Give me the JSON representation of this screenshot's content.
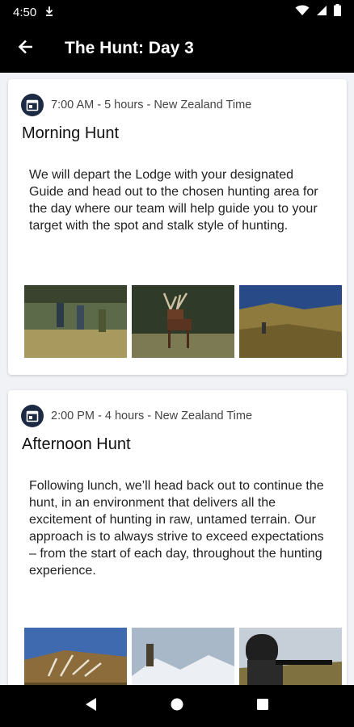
{
  "status_bar": {
    "time": "4:50",
    "icons": [
      "download-icon",
      "wifi-icon",
      "signal-icon",
      "battery-icon"
    ]
  },
  "app_bar": {
    "back_icon": "arrow-back-icon",
    "title": "The Hunt: Day 3"
  },
  "schedule": [
    {
      "meta": "7:00 AM - 5 hours  - New Zealand Time",
      "title": "Morning Hunt",
      "description": "We will depart the Lodge with your designated Guide and head out to the chosen hunting area for the day where our team will help guide you to your target with the spot and stalk style of hunting.",
      "photos": [
        "hunters-walking-photo",
        "red-stag-photo",
        "hillside-hunter-photo"
      ]
    },
    {
      "meta": "2:00 PM - 4 hours  - New Zealand Time",
      "title": "Afternoon Hunt",
      "description": "Following lunch, we’ll head back out to continue the hunt, in an environment that delivers all the excitement of hunting in raw, untamed terrain. Our approach is to always strive to exceed expectations – from the start of each day, throughout the hunting experience.",
      "photos": [
        "antlers-landscape-photo",
        "mountain-hunters-photo",
        "rifle-scope-photo"
      ]
    }
  ],
  "nav_bar": {
    "icons": [
      "nav-back-icon",
      "nav-home-icon",
      "nav-recents-icon"
    ]
  },
  "colors": {
    "bar_background": "#000000",
    "page_background": "#f1f2f6",
    "calendar_icon": "#1d2a44"
  }
}
